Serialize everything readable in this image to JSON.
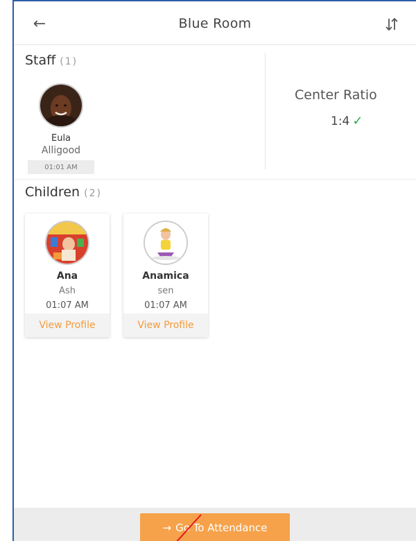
{
  "header": {
    "back_icon": "back-arrow-icon",
    "title": "Blue Room",
    "sort_icon": "sort-icon"
  },
  "staff": {
    "title": "Staff",
    "count": "(1)",
    "members": [
      {
        "first_name": "Eula",
        "last_name": "Alligood",
        "time": "01:01 AM"
      }
    ]
  },
  "ratio": {
    "label": "Center Ratio",
    "value": "1:4",
    "check": "✓"
  },
  "children": {
    "title": "Children",
    "count": "(2)",
    "items": [
      {
        "first_name": "Ana",
        "last_name": "Ash",
        "time": "01:07 AM",
        "action": "View Profile"
      },
      {
        "first_name": "Anamica",
        "last_name": "sen",
        "time": "01:07 AM",
        "action": "View Profile"
      }
    ]
  },
  "footer": {
    "attendance_label": "Go To Attendance",
    "arrow": "→"
  },
  "colors": {
    "accent": "#f5a24b",
    "link": "#f39a3a",
    "check": "#27a844",
    "frame_border": "#2b5da8"
  }
}
